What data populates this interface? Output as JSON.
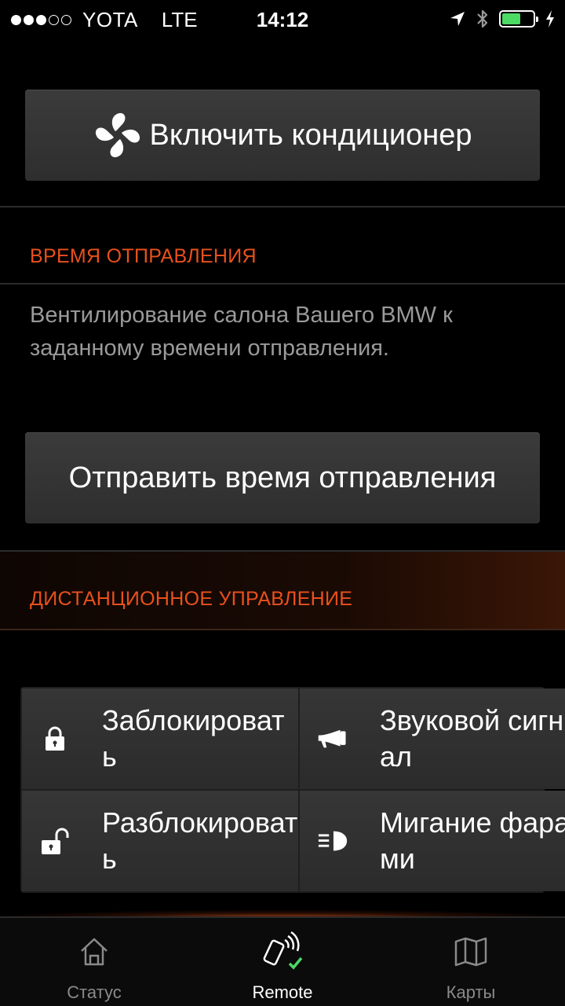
{
  "status_bar": {
    "carrier": "YOTA",
    "network": "LTE",
    "time": "14:12",
    "signal_dots": 5,
    "signal_filled": 3,
    "battery_level": 0.6
  },
  "climate": {
    "ac_button_label": "Включить кондиционер",
    "departure_section_title": "ВРЕМЯ ОТПРАВЛЕНИЯ",
    "departure_description": "Вентилирование салона Вашего BMW к заданному времени отправления.",
    "send_departure_button_label": "Отправить время отправления"
  },
  "remote": {
    "section_title": "ДИСТАНЦИОННОЕ УПРАВЛЕНИЕ",
    "actions": [
      {
        "label": "Заблокировать",
        "icon": "lock-icon"
      },
      {
        "label": "Звуковой сигнал",
        "icon": "horn-icon"
      },
      {
        "label": "Разблокировать",
        "icon": "unlock-icon"
      },
      {
        "label": "Мигание фарами",
        "icon": "headlight-flash-icon"
      }
    ]
  },
  "tabs": [
    {
      "label": "Статус",
      "icon": "home-icon",
      "active": false
    },
    {
      "label": "Remote",
      "icon": "remote-phone-icon",
      "active": true
    },
    {
      "label": "Карты",
      "icon": "map-icon",
      "active": false
    }
  ],
  "colors": {
    "accent": "#e8501c",
    "background": "#000000",
    "button": "#333333",
    "success_check": "#4cd964"
  }
}
